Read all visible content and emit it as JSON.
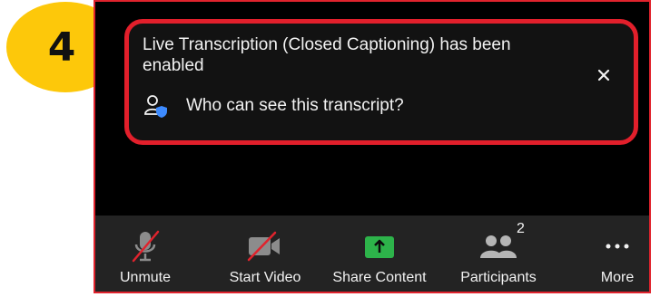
{
  "step": {
    "number": "4"
  },
  "notification": {
    "message": "Live Transcription (Closed Captioning) has been enabled",
    "link_label": "Who can see this transcript?",
    "close_icon": "close-icon",
    "link_icon": "person-shield-icon"
  },
  "toolbar": {
    "items": [
      {
        "label": "Unmute",
        "icon": "microphone-muted-icon"
      },
      {
        "label": "Start Video",
        "icon": "video-off-icon"
      },
      {
        "label": "Share Content",
        "icon": "share-arrow-icon"
      },
      {
        "label": "Participants",
        "icon": "participants-icon",
        "count": "2"
      },
      {
        "label": "More",
        "icon": "more-dots-icon"
      }
    ]
  },
  "colors": {
    "badge": "#FDC80A",
    "highlight": "#E21F2B",
    "share_green": "#35C759",
    "toolbar_bg": "#232323"
  }
}
